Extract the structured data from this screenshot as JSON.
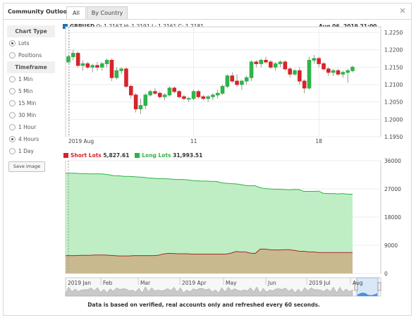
{
  "header": {
    "title": "Community Outlook",
    "tabs": [
      {
        "label": "All",
        "active": true
      },
      {
        "label": "By Country",
        "active": false
      }
    ]
  },
  "sidebar": {
    "chart_type_header": "Chart Type",
    "chart_type_options": [
      {
        "label": "Lots",
        "selected": true
      },
      {
        "label": "Positions",
        "selected": false
      }
    ],
    "timeframe_header": "Timeframe",
    "timeframe_options": [
      {
        "label": "1 Min",
        "selected": false
      },
      {
        "label": "5 Min",
        "selected": false
      },
      {
        "label": "15 Min",
        "selected": false
      },
      {
        "label": "30 Min",
        "selected": false
      },
      {
        "label": "1 Hour",
        "selected": false
      },
      {
        "label": "4 Hours",
        "selected": true
      },
      {
        "label": "1 Day",
        "selected": false
      }
    ],
    "save_label": "Save image"
  },
  "price_chart": {
    "symbol": "GBPUSD",
    "ohlc_text": "O: 1.2167 H: 1.2191 L: 1.2161 C: 1.2181",
    "datetime": "Aug 06, 2019 21:00",
    "x_labels": [
      "2019 Aug",
      "11",
      "18"
    ],
    "y_ticks": [
      "1.2250",
      "1.2200",
      "1.2150",
      "1.2100",
      "1.2050",
      "1.2000",
      "1.1950"
    ]
  },
  "lots_chart": {
    "short_label": "Short Lots",
    "short_value": "5,827.61",
    "long_label": "Long Lots",
    "long_value": "31,993.51",
    "y_ticks": [
      "36000",
      "27000",
      "18000",
      "9000",
      "0"
    ]
  },
  "navigator": {
    "labels": [
      "2019 Jan",
      "Feb",
      "Mar",
      "2019 Apr",
      "May",
      "Jun",
      "2019 Jul",
      "Aug"
    ]
  },
  "colors": {
    "up": "#2fb34a",
    "down": "#d8232a",
    "long_fill": "#bfeec5",
    "short_fill": "#c9b98f",
    "short_line": "#a52a2a",
    "symbol": "#1f6fb2"
  },
  "footer": "Data is based on verified, real accounts only and refreshed every 60 seconds.",
  "chart_data": [
    {
      "type": "candlestick",
      "title": "GBPUSD",
      "ylim": [
        1.195,
        1.225
      ],
      "x_tick_labels": [
        "2019 Aug",
        "11",
        "18"
      ],
      "candles_ohlc": [
        [
          1.2165,
          1.2185,
          1.216,
          1.218
        ],
        [
          1.218,
          1.22,
          1.217,
          1.219
        ],
        [
          1.219,
          1.2195,
          1.215,
          1.2155
        ],
        [
          1.2155,
          1.217,
          1.214,
          1.216
        ],
        [
          1.216,
          1.2165,
          1.2145,
          1.215
        ],
        [
          1.215,
          1.216,
          1.2135,
          1.2155
        ],
        [
          1.2155,
          1.2165,
          1.214,
          1.215
        ],
        [
          1.215,
          1.2165,
          1.214,
          1.216
        ],
        [
          1.216,
          1.2175,
          1.215,
          1.217
        ],
        [
          1.217,
          1.2175,
          1.211,
          1.212
        ],
        [
          1.212,
          1.215,
          1.2115,
          1.214
        ],
        [
          1.214,
          1.215,
          1.213,
          1.2145
        ],
        [
          1.2145,
          1.215,
          1.209,
          1.2095
        ],
        [
          1.2095,
          1.21,
          1.206,
          1.207
        ],
        [
          1.207,
          1.2075,
          1.202,
          1.203
        ],
        [
          1.203,
          1.206,
          1.2015,
          1.204
        ],
        [
          1.204,
          1.2075,
          1.203,
          1.207
        ],
        [
          1.207,
          1.2085,
          1.2065,
          1.208
        ],
        [
          1.208,
          1.209,
          1.207,
          1.2075
        ],
        [
          1.2075,
          1.208,
          1.206,
          1.2065
        ],
        [
          1.2065,
          1.2075,
          1.2055,
          1.207
        ],
        [
          1.207,
          1.2095,
          1.2065,
          1.209
        ],
        [
          1.209,
          1.2095,
          1.2075,
          1.208
        ],
        [
          1.208,
          1.2085,
          1.206,
          1.2065
        ],
        [
          1.2065,
          1.207,
          1.2055,
          1.206
        ],
        [
          1.206,
          1.2065,
          1.205,
          1.206
        ],
        [
          1.206,
          1.2085,
          1.2055,
          1.208
        ],
        [
          1.208,
          1.2085,
          1.206,
          1.2065
        ],
        [
          1.2065,
          1.207,
          1.2055,
          1.206
        ],
        [
          1.206,
          1.207,
          1.205,
          1.2065
        ],
        [
          1.2065,
          1.2075,
          1.2055,
          1.207
        ],
        [
          1.207,
          1.2085,
          1.206,
          1.2075
        ],
        [
          1.2075,
          1.21,
          1.207,
          1.2095
        ],
        [
          1.2095,
          1.213,
          1.209,
          1.2125
        ],
        [
          1.2125,
          1.2135,
          1.2105,
          1.211
        ],
        [
          1.211,
          1.213,
          1.2095,
          1.21
        ],
        [
          1.21,
          1.2115,
          1.2085,
          1.211
        ],
        [
          1.211,
          1.2125,
          1.21,
          1.212
        ],
        [
          1.212,
          1.217,
          1.211,
          1.2165
        ],
        [
          1.2165,
          1.217,
          1.215,
          1.216
        ],
        [
          1.216,
          1.2175,
          1.215,
          1.217
        ],
        [
          1.217,
          1.218,
          1.216,
          1.2165
        ],
        [
          1.2165,
          1.217,
          1.2145,
          1.215
        ],
        [
          1.215,
          1.2165,
          1.214,
          1.216
        ],
        [
          1.216,
          1.217,
          1.215,
          1.2165
        ],
        [
          1.2165,
          1.217,
          1.214,
          1.2145
        ],
        [
          1.2145,
          1.215,
          1.212,
          1.213
        ],
        [
          1.213,
          1.2145,
          1.2125,
          1.214
        ],
        [
          1.214,
          1.215,
          1.21,
          1.211
        ],
        [
          1.211,
          1.2115,
          1.2075,
          1.209
        ],
        [
          1.209,
          1.218,
          1.2085,
          1.217
        ],
        [
          1.217,
          1.2185,
          1.216,
          1.2175
        ],
        [
          1.2175,
          1.218,
          1.215,
          1.216
        ],
        [
          1.216,
          1.2165,
          1.214,
          1.2145
        ],
        [
          1.2145,
          1.215,
          1.2125,
          1.2135
        ],
        [
          1.2135,
          1.2145,
          1.2125,
          1.214
        ],
        [
          1.214,
          1.2145,
          1.2125,
          1.213
        ],
        [
          1.213,
          1.214,
          1.212,
          1.2135
        ],
        [
          1.2135,
          1.2145,
          1.2105,
          1.214
        ],
        [
          1.214,
          1.2155,
          1.2135,
          1.215
        ]
      ]
    },
    {
      "type": "area",
      "series": [
        {
          "name": "Long Lots",
          "values": [
            32000,
            32000,
            32000,
            31900,
            31900,
            31800,
            31800,
            31800,
            31700,
            31500,
            31200,
            31200,
            31000,
            31000,
            30900,
            30800,
            30700,
            30500,
            30400,
            30300,
            30300,
            30200,
            30100,
            30000,
            30000,
            29900,
            29700,
            29600,
            29500,
            29500,
            29400,
            29400,
            29000,
            28800,
            28700,
            28600,
            28400,
            28100,
            28000,
            28000,
            27400,
            27100,
            27000,
            26900,
            26900,
            26800,
            26700,
            26800,
            26800,
            26200,
            26200,
            26200,
            26300,
            25600,
            25500,
            25500,
            25400,
            25500,
            25300,
            25300
          ]
        },
        {
          "name": "Short Lots",
          "values": [
            5700,
            5700,
            5700,
            5800,
            5800,
            5800,
            5900,
            5900,
            5900,
            5800,
            5700,
            5600,
            5600,
            5600,
            5700,
            5700,
            5700,
            5700,
            5700,
            5800,
            6200,
            6400,
            6400,
            6300,
            6300,
            6300,
            6200,
            6200,
            6200,
            6200,
            6200,
            6200,
            6200,
            6200,
            6500,
            7000,
            6900,
            6900,
            6500,
            6400,
            7800,
            7800,
            7600,
            7500,
            7500,
            7600,
            7600,
            7400,
            7100,
            7100,
            6900,
            6900,
            6700,
            6700,
            6700,
            6700,
            6700,
            6700,
            6700,
            6700
          ]
        }
      ],
      "ylim": [
        0,
        36000
      ],
      "y_tick_labels": [
        "36000",
        "27000",
        "18000",
        "9000",
        "0"
      ]
    }
  ]
}
